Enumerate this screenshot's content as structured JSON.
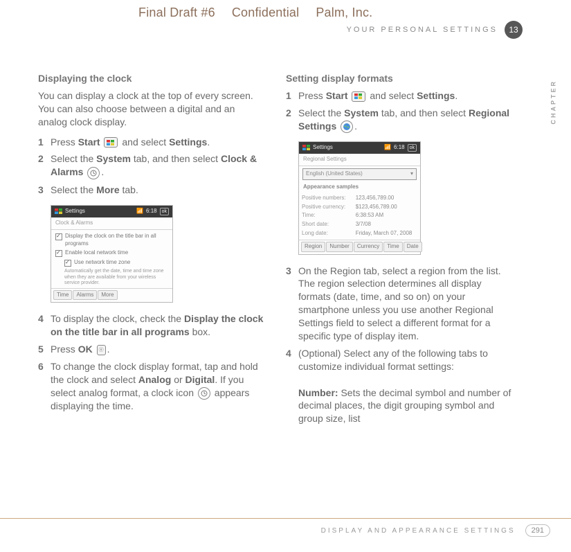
{
  "top": {
    "a": "Final Draft #6",
    "b": "Confidential",
    "c": "Palm, Inc."
  },
  "header": {
    "section": "YOUR PERSONAL SETTINGS",
    "chapter_no": "13",
    "chapter_label": "CHAPTER"
  },
  "left": {
    "heading": "Displaying the clock",
    "intro": "You can display a clock at the top of every screen. You can also choose between a digital and an analog clock display.",
    "step1_a": "Press ",
    "step1_b": "Start",
    "step1_c": " and select ",
    "step1_d": "Settings",
    "step1_e": ".",
    "step2_a": "Select the ",
    "step2_b": "System",
    "step2_c": " tab, and then select ",
    "step2_d": "Clock & Alarms",
    "step2_e": ".",
    "step3_a": "Select the ",
    "step3_b": "More",
    "step3_c": " tab.",
    "step4_a": "To display the clock, check the ",
    "step4_b": "Display the clock on the title bar in all programs",
    "step4_c": " box.",
    "step5_a": "Press ",
    "step5_b": "OK",
    "step5_c": ".",
    "step6_a": "To change the clock display format, tap and hold the clock and select ",
    "step6_b": "Analog",
    "step6_c": " or ",
    "step6_d": "Digital",
    "step6_e": ". If you select analog format, a clock icon ",
    "step6_f": " appears displaying the time."
  },
  "right": {
    "heading": "Setting display formats",
    "step1_a": "Press ",
    "step1_b": "Start",
    "step1_c": " and select ",
    "step1_d": "Settings",
    "step1_e": ".",
    "step2_a": "Select the ",
    "step2_b": "System",
    "step2_c": " tab, and then select ",
    "step2_d": "Regional Settings",
    "step2_e": ".",
    "step3": "On the Region tab, select a region from the list. The region selection determines all display formats (date, time, and so on) on your smartphone unless you use another Regional Settings field to select a different format for a specific type of display item.",
    "step4_a": "(Optional) Select any of the following tabs to customize individual format settings:",
    "step4_number_a": "Number:",
    "step4_number_b": " Sets the decimal symbol and number of decimal places, the digit grouping symbol and group size, list"
  },
  "shot1": {
    "title": "Settings",
    "time": "6:18",
    "sub": "Clock & Alarms",
    "chk1": "Display the clock on the title bar in all programs",
    "chk2": "Enable local network time",
    "chk3": "Use network time zone",
    "note": "Automatically get the date, time and time zone when they are available from your wireless service provider.",
    "t1": "Time",
    "t2": "Alarms",
    "t3": "More"
  },
  "shot2": {
    "title": "Settings",
    "time": "6:18",
    "sub": "Regional Settings",
    "dd": "English (United States)",
    "sect": "Appearance samples",
    "r1a": "Positive numbers:",
    "r1b": "123,456,789.00",
    "r2a": "Positive currency:",
    "r2b": "$123,456,789.00",
    "r3a": "Time:",
    "r3b": "6:38:53 AM",
    "r4a": "Short date:",
    "r4b": "3/7/08",
    "r5a": "Long date:",
    "r5b": "Friday, March 07, 2008",
    "t1": "Region",
    "t2": "Number",
    "t3": "Currency",
    "t4": "Time",
    "t5": "Date"
  },
  "footer": {
    "label": "DISPLAY AND APPEARANCE SETTINGS",
    "page": "291"
  }
}
